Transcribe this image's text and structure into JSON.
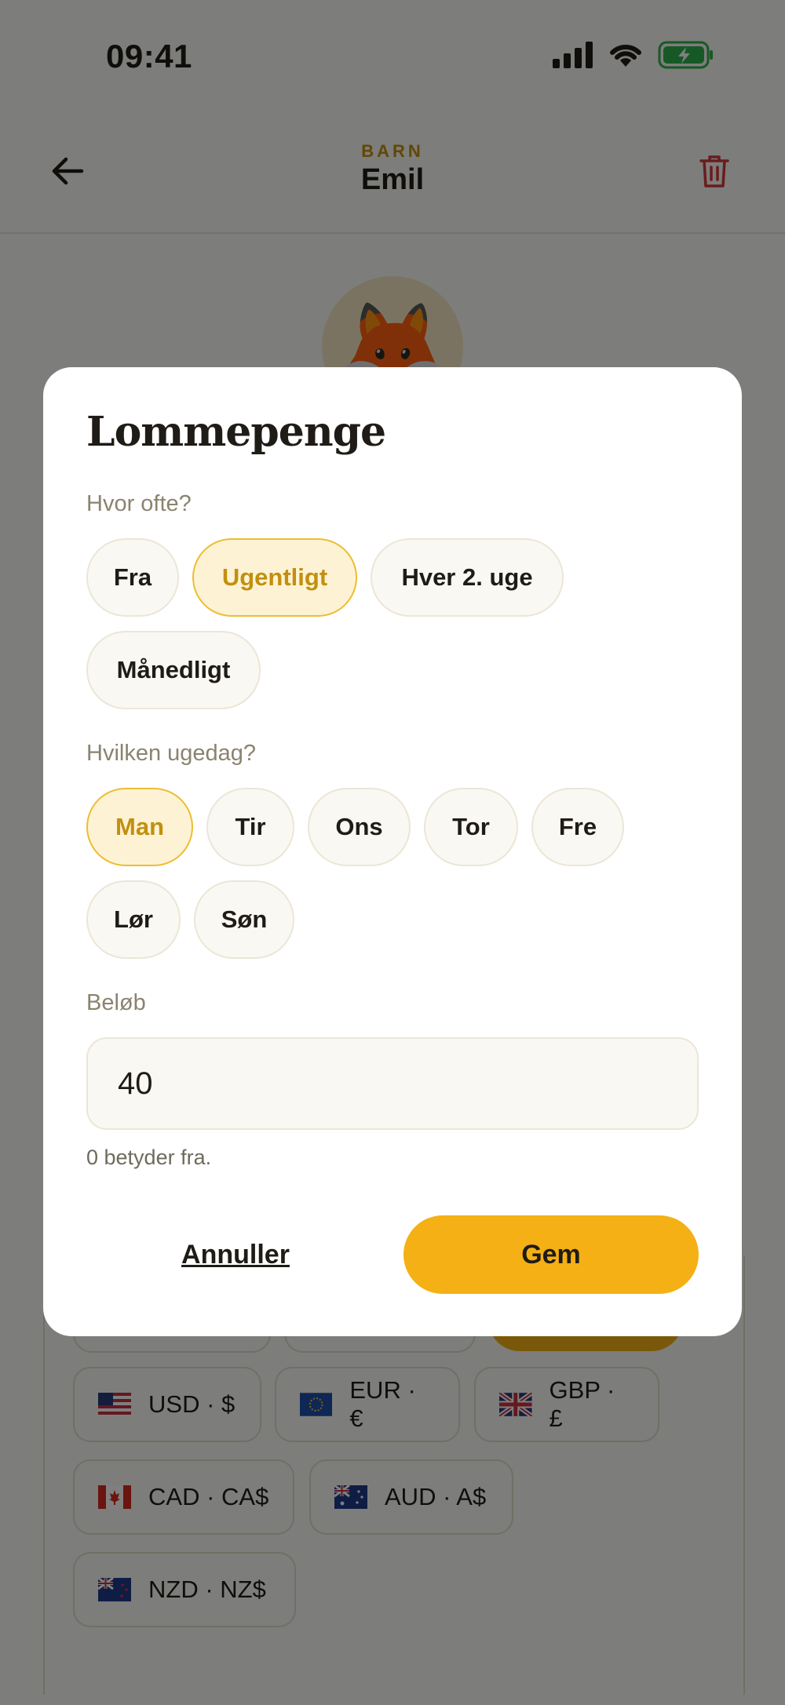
{
  "status_bar": {
    "time": "09:41"
  },
  "nav": {
    "eyebrow": "BARN",
    "name": "Emil"
  },
  "avatar": {
    "emoji": "🦊"
  },
  "currencies": [
    {
      "flag": "us-flag",
      "label": "USD · $"
    },
    {
      "flag": "eu-flag",
      "label": "EUR · €"
    },
    {
      "flag": "gb-flag",
      "label": "GBP · £"
    },
    {
      "flag": "ca-flag",
      "label": "CAD · CA$"
    },
    {
      "flag": "au-flag",
      "label": "AUD · A$"
    },
    {
      "flag": "nz-flag",
      "label": "NZD · NZ$"
    }
  ],
  "modal": {
    "title": "Lommepenge",
    "frequency_label": "Hvor ofte?",
    "frequency_options": [
      "Fra",
      "Ugentligt",
      "Hver 2. uge",
      "Månedligt"
    ],
    "frequency_selected": "Ugentligt",
    "weekday_label": "Hvilken ugedag?",
    "weekday_options": [
      "Man",
      "Tir",
      "Ons",
      "Tor",
      "Fre",
      "Lør",
      "Søn"
    ],
    "weekday_selected": "Man",
    "amount_label": "Beløb",
    "amount_value": "40",
    "hint": "0 betyder fra.",
    "cancel_label": "Annuller",
    "save_label": "Gem"
  },
  "colors": {
    "accent": "#f4b014",
    "accent_text": "#c28f10",
    "danger": "#d03a3a"
  }
}
